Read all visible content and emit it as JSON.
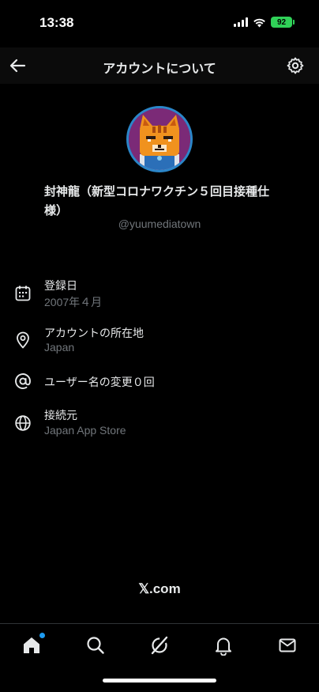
{
  "status_bar": {
    "time": "13:38",
    "battery": "92",
    "icons": [
      "signal-icon",
      "wifi-icon",
      "battery-icon"
    ]
  },
  "header": {
    "title": "アカウントについて",
    "back_icon": "arrow-left-icon",
    "settings_icon": "gear-icon"
  },
  "profile": {
    "display_name": "封神龍（新型コロナワクチン５回目接種仕様）",
    "handle": "@yuumediatown"
  },
  "info": [
    {
      "icon": "calendar-icon",
      "label": "登録日",
      "value": "2007年４月"
    },
    {
      "icon": "location-pin-icon",
      "label": "アカウントの所在地",
      "value": "Japan"
    },
    {
      "icon": "at-sign-icon",
      "label": "ユーザー名の変更０回",
      "value": ""
    },
    {
      "icon": "globe-icon",
      "label": "接続元",
      "value": "Japan App Store"
    }
  ],
  "footer": {
    "brand": "𝕏.com"
  },
  "tabbar": {
    "items": [
      "home-icon",
      "search-icon",
      "grok-icon",
      "bell-icon",
      "mail-icon"
    ],
    "home_has_notification": true
  },
  "colors": {
    "background": "#000000",
    "text_primary": "#e7e9ea",
    "text_secondary": "#71767b",
    "accent": "#1d9bf0",
    "battery": "#30d158"
  }
}
